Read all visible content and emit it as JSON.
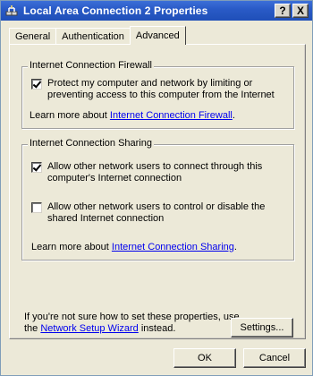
{
  "window": {
    "title": "Local Area Connection 2 Properties",
    "help_button": "?",
    "close_button": "X"
  },
  "tabs": [
    {
      "label": "General",
      "active": false
    },
    {
      "label": "Authentication",
      "active": false
    },
    {
      "label": "Advanced",
      "active": true
    }
  ],
  "firewall": {
    "group_title": "Internet Connection Firewall",
    "checkbox_label": "Protect my computer and network by limiting or preventing access to this computer from the Internet",
    "checked": true,
    "learn_prefix": "Learn more about ",
    "learn_link": "Internet Connection Firewall",
    "learn_suffix": "."
  },
  "sharing": {
    "group_title": "Internet Connection Sharing",
    "allow_connect_label": "Allow other network users to connect through this computer's Internet connection",
    "allow_connect_checked": true,
    "allow_control_label": "Allow other network users to control or disable the shared Internet connection",
    "allow_control_checked": false,
    "learn_prefix": "Learn more about ",
    "learn_link": "Internet Connection Sharing",
    "learn_suffix": "."
  },
  "help_text": {
    "prefix": "If you're not sure how to set these properties, use the ",
    "link": "Network Setup Wizard",
    "suffix": " instead."
  },
  "buttons": {
    "settings": "Settings...",
    "ok": "OK",
    "cancel": "Cancel"
  },
  "icons": {
    "title_icon": "network-connection-icon"
  }
}
